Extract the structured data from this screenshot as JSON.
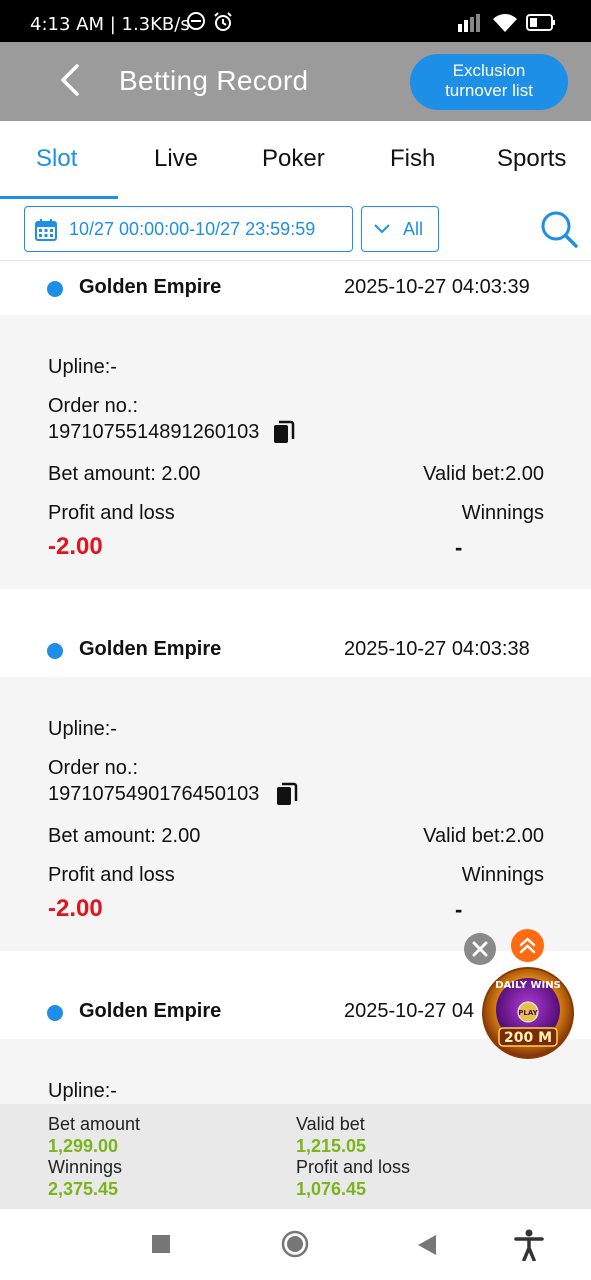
{
  "status_bar": {
    "time": "4:13 AM | 1.3KB/s"
  },
  "header": {
    "title": "Betting Record",
    "exclusion_line1": "Exclusion",
    "exclusion_line2": "turnover list"
  },
  "tabs": [
    "Slot",
    "Live",
    "Poker",
    "Fish",
    "Sports"
  ],
  "filter": {
    "date_range": "10/27 00:00:00-10/27 23:59:59",
    "type": "All"
  },
  "labels": {
    "upline": "Upline:",
    "order_no": "Order no.:",
    "bet_amount": "Bet amount:",
    "valid_bet": "Valid bet:",
    "profit_loss": "Profit and loss",
    "winnings": "Winnings"
  },
  "records": [
    {
      "game": "Golden Empire",
      "time": "2025-10-27 04:03:39",
      "upline": "-",
      "order_no": "1971075514891260103",
      "bet_amount": "2.00",
      "valid_bet": "2.00",
      "profit_loss": "-2.00",
      "winnings": "-"
    },
    {
      "game": "Golden Empire",
      "time": "2025-10-27 04:03:38",
      "upline": "-",
      "order_no": "1971075490176450103",
      "bet_amount": "2.00",
      "valid_bet": "2.00",
      "profit_loss": "-2.00",
      "winnings": "-"
    },
    {
      "game": "Golden Empire",
      "time": "2025-10-27 04",
      "upline": "-"
    }
  ],
  "summary": {
    "bet_amount_label": "Bet amount",
    "bet_amount": "1,299.00",
    "valid_bet_label": "Valid bet",
    "valid_bet": "1,215.05",
    "winnings_label": "Winnings",
    "winnings": "2,375.45",
    "profit_loss_label": "Profit and loss",
    "profit_loss": "1,076.45"
  },
  "promo": {
    "line1": "DAILY WINS",
    "play": "PLAY",
    "amount": "200 M"
  },
  "colors": {
    "accent": "#1e8fe6",
    "loss": "#e0141e",
    "positive": "#7ab51d",
    "header_bg": "#9b9b9b"
  }
}
